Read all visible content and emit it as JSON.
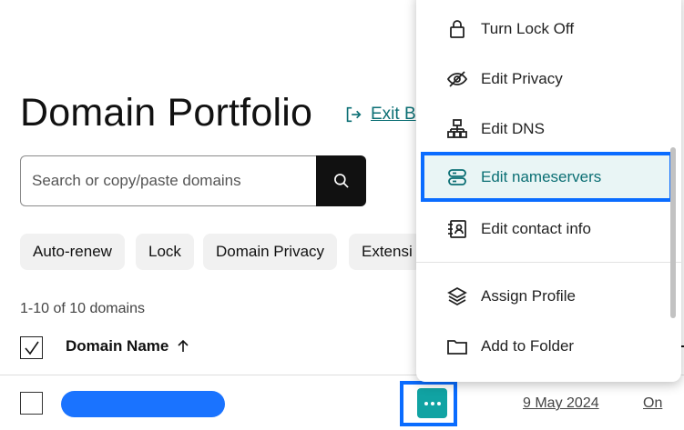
{
  "page": {
    "title": "Domain Portfolio",
    "exit_link": "Exit B",
    "search_placeholder": "Search or copy/paste domains"
  },
  "filters": [
    "Auto-renew",
    "Lock",
    "Domain Privacy",
    "Extensi"
  ],
  "results": {
    "count_text": "1-10 of 10 domains"
  },
  "table": {
    "column_header": "Domain Name",
    "row": {
      "date": "9 May 2024",
      "status": "On"
    }
  },
  "menu": {
    "items": [
      {
        "label": "Turn Lock Off",
        "icon": "lock-icon"
      },
      {
        "label": "Edit Privacy",
        "icon": "eye-off-icon"
      },
      {
        "label": "Edit DNS",
        "icon": "dns-icon"
      },
      {
        "label": "Edit nameservers",
        "icon": "nameserver-icon"
      },
      {
        "label": "Edit contact info",
        "icon": "contact-card-icon"
      },
      {
        "label": "Assign Profile",
        "icon": "layers-icon"
      },
      {
        "label": "Add to Folder",
        "icon": "folder-icon"
      }
    ]
  },
  "colors": {
    "accent_teal": "#0b6f74",
    "highlight_blue": "#0a6cff",
    "domain_pill": "#1a73ff",
    "more_button": "#11a3a3"
  }
}
